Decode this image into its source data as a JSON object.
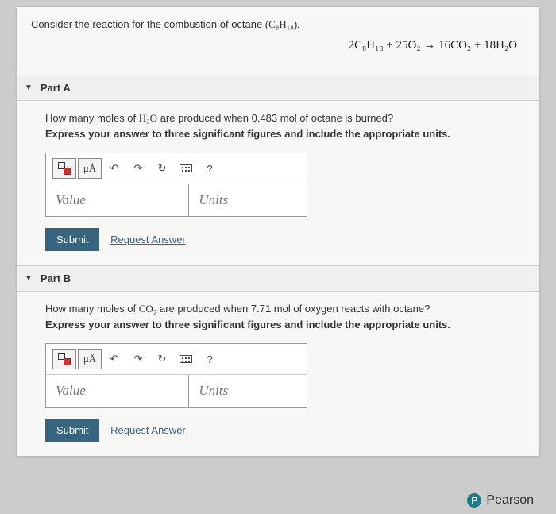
{
  "intro": {
    "text_before": "Consider the reaction for the combustion of octane ",
    "formula": "(C₈H₁₈).",
    "equation": "2C₈H₁₈ + 25O₂ → 16CO₂ + 18H₂O"
  },
  "toolbar": {
    "units_symbol": "μÅ",
    "undo": "↶",
    "redo": "↷",
    "reset": "↻",
    "help": "?"
  },
  "partA": {
    "title": "Part A",
    "question_before": "How many moles of ",
    "question_mol": "H₂O",
    "question_after": " are produced when 0.483 mol of octane is burned?",
    "instruction": "Express your answer to three significant figures and include the appropriate units.",
    "value_ph": "Value",
    "units_ph": "Units",
    "submit": "Submit",
    "request": "Request Answer"
  },
  "partB": {
    "title": "Part B",
    "question_before": "How many moles of ",
    "question_mol": "CO₂",
    "question_after": " are produced when 7.71 mol of oxygen reacts with octane?",
    "instruction": "Express your answer to three significant figures and include the appropriate units.",
    "value_ph": "Value",
    "units_ph": "Units",
    "submit": "Submit",
    "request": "Request Answer"
  },
  "brand": "Pearson"
}
